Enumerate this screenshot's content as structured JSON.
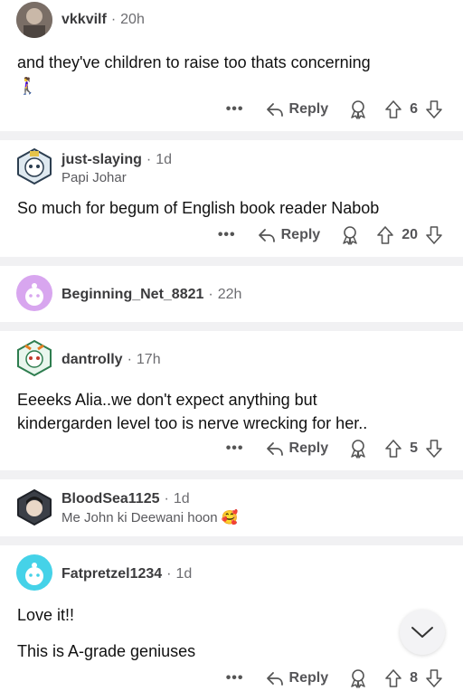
{
  "comments": [
    {
      "username": "vkkvilf",
      "time": "20h",
      "body_lines": [
        "and they've children to raise too thats concerning",
        "🚶‍♀️"
      ],
      "reply_label": "Reply",
      "votes": "6"
    },
    {
      "username": "just-slaying",
      "time": "1d",
      "flair": "Papi Johar",
      "body_lines": [
        "So much for begum of English book reader Nabob"
      ],
      "reply_label": "Reply",
      "votes": "20"
    },
    {
      "username": "Beginning_Net_8821",
      "time": "22h"
    },
    {
      "username": "dantrolly",
      "time": "17h",
      "body_lines": [
        "Eeeeks Alia..we don't expect anything but",
        "kindergarden level too is nerve wrecking for her.."
      ],
      "reply_label": "Reply",
      "votes": "5"
    },
    {
      "username": "BloodSea1125",
      "time": "1d",
      "flair": "Me John ki Deewani hoon 🥰"
    },
    {
      "username": "Fatpretzel1234",
      "time": "1d",
      "body_lines": [
        "Love it!!",
        "This is A-grade geniuses"
      ],
      "reply_label": "Reply",
      "votes": "8"
    }
  ],
  "more_label": "•••",
  "colors": {
    "separator": "#f1f1f3",
    "username": "#3b3b3d",
    "meta": "#6c6c70",
    "avatar_purple": "#d8a6ef",
    "avatar_cyan": "#45d2e8"
  }
}
